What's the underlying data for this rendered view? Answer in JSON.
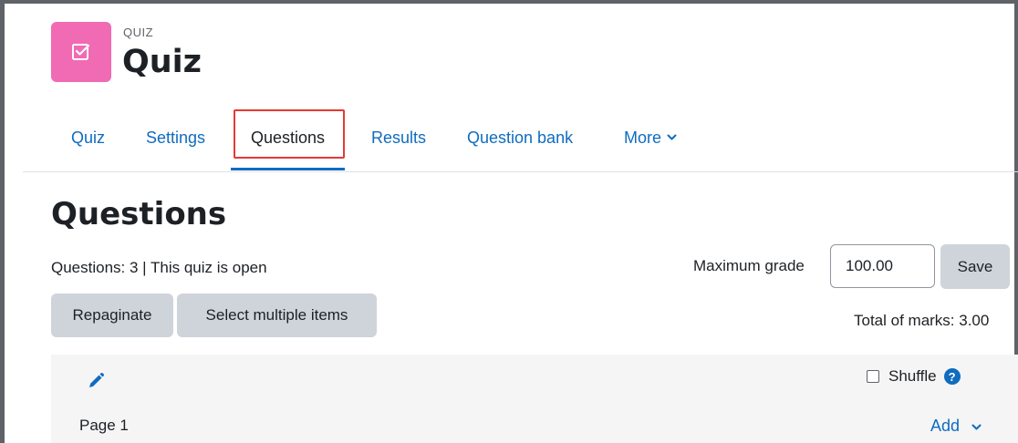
{
  "header": {
    "activity_type": "QUIZ",
    "activity_title": "Quiz",
    "icon": "checkbox-icon",
    "icon_bg": "#f16ab4"
  },
  "tabs": [
    {
      "label": "Quiz",
      "active": false
    },
    {
      "label": "Settings",
      "active": false
    },
    {
      "label": "Questions",
      "active": true
    },
    {
      "label": "Results",
      "active": false
    },
    {
      "label": "Question bank",
      "active": false
    },
    {
      "label": "More",
      "active": false,
      "dropdown": true
    }
  ],
  "main": {
    "heading": "Questions",
    "status": "Questions: 3 | This quiz is open",
    "max_grade_label": "Maximum grade",
    "max_grade_value": "100.00",
    "save_label": "Save",
    "repaginate_label": "Repaginate",
    "select_multiple_label": "Select multiple items",
    "total_marks": "Total of marks: 3.00"
  },
  "section": {
    "shuffle_label": "Shuffle",
    "shuffle_checked": false,
    "page_label": "Page 1",
    "add_label": "Add"
  },
  "colors": {
    "link": "#0f6cbf",
    "highlight": "#e53935",
    "button_bg": "#ced4da"
  }
}
